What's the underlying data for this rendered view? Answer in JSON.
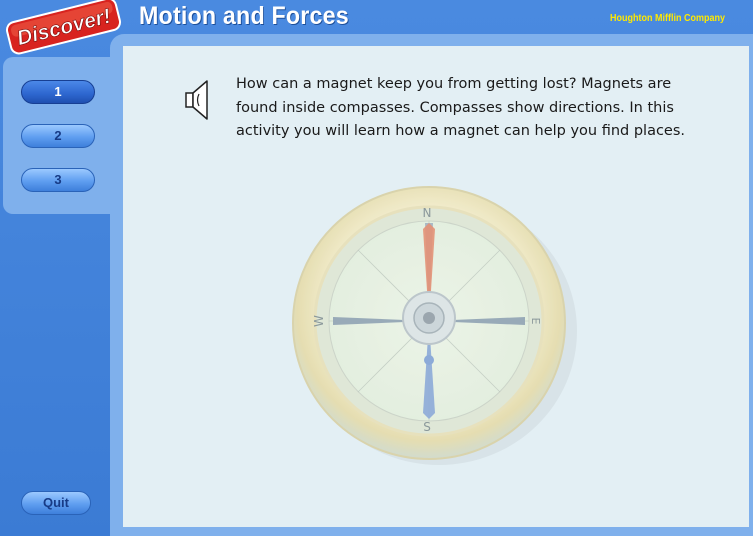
{
  "header": {
    "logo_text": "Discover!",
    "title": "Motion and Forces",
    "publisher": "Houghton Mifflin Company"
  },
  "nav": {
    "items": [
      {
        "label": "1",
        "active": true
      },
      {
        "label": "2",
        "active": false
      },
      {
        "label": "3",
        "active": false
      }
    ],
    "quit_label": "Quit"
  },
  "content": {
    "paragraph": "How can a magnet keep you from getting lost?  Magnets are found inside compasses. Compasses show directions. In this activity you will learn how a magnet can help you find places.",
    "compass": {
      "north": "N",
      "south": "S",
      "east": "E",
      "west": "W"
    }
  },
  "colors": {
    "background_blue": "#3f7fd6",
    "panel_blue": "#7fb0ec",
    "content_bg": "#e3eff4",
    "publisher_yellow": "#ffe900",
    "logo_red": "#d8231f"
  },
  "icons": {
    "speaker": "speaker-icon",
    "compass": "compass-image"
  }
}
